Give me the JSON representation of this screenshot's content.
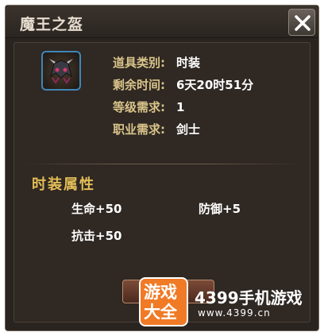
{
  "dialog": {
    "title": "魔王之盔",
    "info": [
      {
        "label": "道具类别:",
        "value": "时装"
      },
      {
        "label": "剩余时间:",
        "value": "6天20时51分"
      },
      {
        "label": "等级需求:",
        "value": "1"
      },
      {
        "label": "职业需求:",
        "value": "剑士"
      }
    ],
    "section_title": "时装属性",
    "attributes": [
      "生命+50",
      "防御+5",
      "抗击+50"
    ]
  },
  "watermark": {
    "badge_line1": "游戏",
    "badge_line2": "大全",
    "site_name": "4399手机游戏",
    "url": "www.4399.cn"
  },
  "icons": {
    "close": "close-icon",
    "item": "helmet-icon"
  },
  "colors": {
    "label_gold": "#d9c48a",
    "section_gold": "#e2bd56",
    "icon_border_blue": "#3f86b8",
    "watermark_orange": "#f07a26"
  }
}
